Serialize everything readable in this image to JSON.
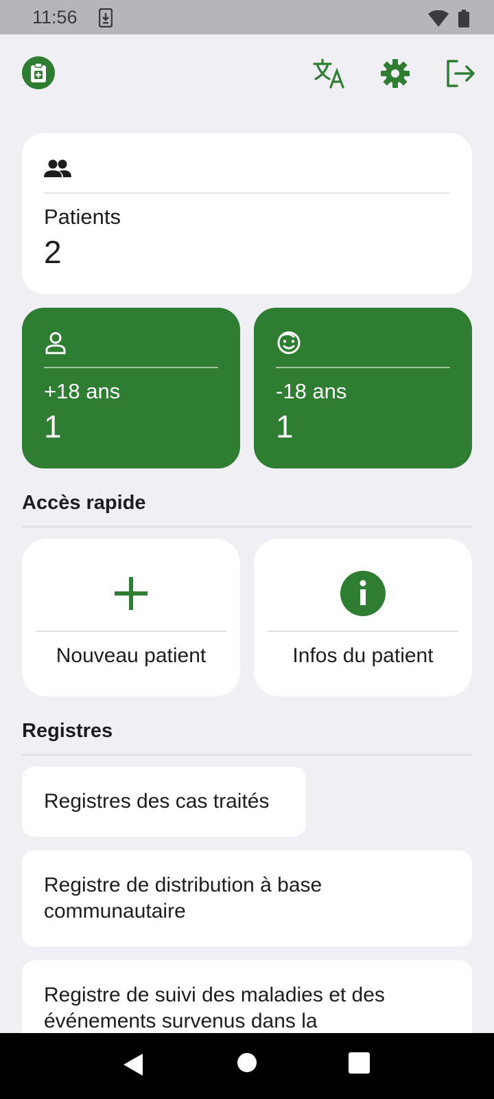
{
  "status_bar": {
    "time": "11:56"
  },
  "header": {
    "logo_icon": "clipboard-medical-icon",
    "actions": [
      {
        "name": "translate-icon"
      },
      {
        "name": "gear-icon"
      },
      {
        "name": "logout-icon"
      }
    ]
  },
  "stats": {
    "patients": {
      "icon": "people-icon",
      "label": "Patients",
      "value": "2"
    },
    "adults": {
      "icon": "person-outline-icon",
      "label": "+18 ans",
      "value": "1"
    },
    "children": {
      "icon": "baby-face-icon",
      "label": "-18 ans",
      "value": "1"
    }
  },
  "quick_access": {
    "title": "Accès rapide",
    "items": [
      {
        "icon": "plus-icon",
        "label": "Nouveau patient"
      },
      {
        "icon": "info-icon",
        "label": "Infos du patient"
      }
    ]
  },
  "registers": {
    "title": "Registres",
    "items": [
      {
        "label": "Registres des cas traités"
      },
      {
        "label": "Registre de distribution à base communautaire"
      },
      {
        "label": "Registre de suivi des maladies et des événements survenus dans la"
      }
    ]
  },
  "colors": {
    "accent": "#2e7d32",
    "background": "#efeff4",
    "card": "#ffffff"
  }
}
